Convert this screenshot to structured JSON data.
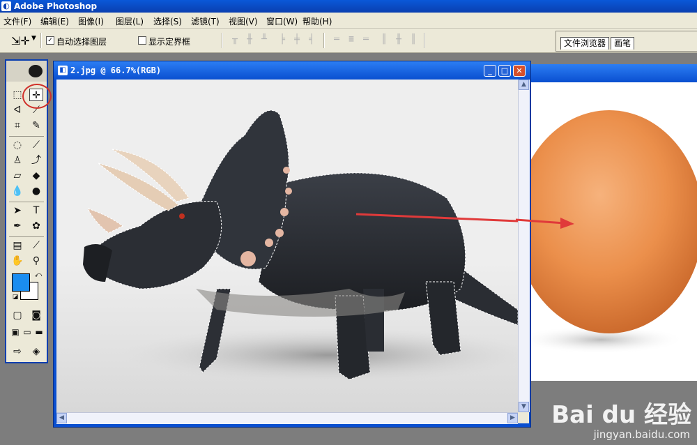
{
  "app": {
    "title": "Adobe Photoshop"
  },
  "menu": [
    "文件(F)",
    "编辑(E)",
    "图像(I)",
    "图层(L)",
    "选择(S)",
    "滤镜(T)",
    "视图(V)",
    "窗口(W)",
    "帮助(H)"
  ],
  "options": {
    "auto_select_label": "自动选择图层",
    "auto_select_checked": "✓",
    "show_bounds_label": "显示定界框"
  },
  "palette_well": {
    "tabs": [
      "文件浏览器",
      "画笔"
    ]
  },
  "document": {
    "title": "2.jpg @ 66.7%(RGB)"
  },
  "colors": {
    "foreground": "#1a8df0",
    "background": "#ffffff",
    "annotation": "#d0302a"
  },
  "watermark": {
    "brand": "Bai du 经验",
    "url": "jingyan.baidu.com"
  }
}
